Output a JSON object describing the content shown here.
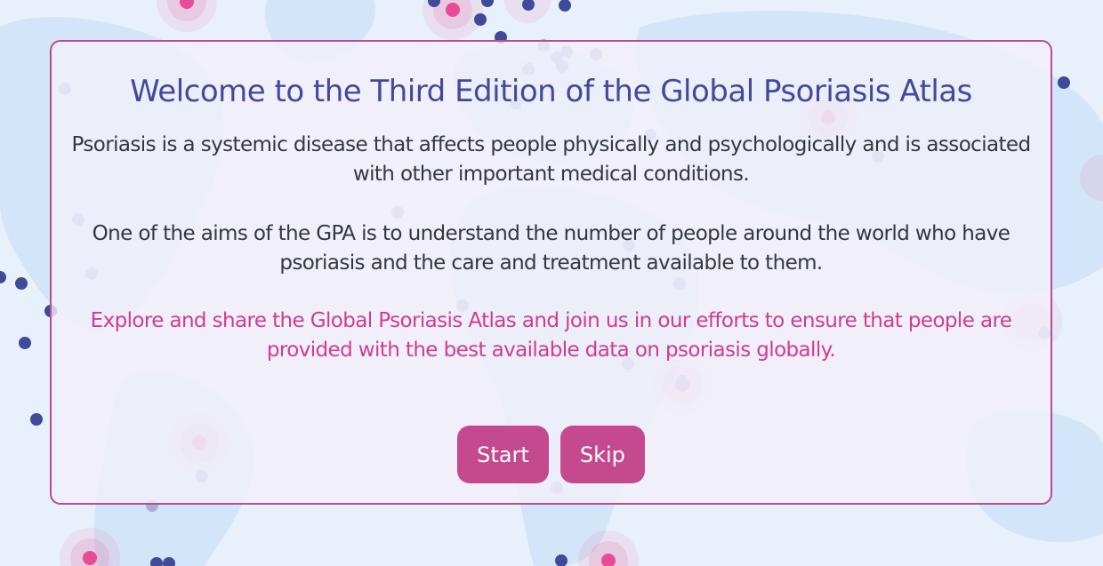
{
  "colors": {
    "background": "#e8f1fb",
    "land": "#d3e5f8",
    "title": "#414a9b",
    "body_text": "#333740",
    "highlight_text": "#d03c8f",
    "button": "#c4498e",
    "border": "#b84d8f",
    "dot_navy": "#3f4a99",
    "dot_pink": "#e84c96"
  },
  "modal": {
    "title": "Welcome to the Third Edition of the Global Psoriasis Atlas",
    "paragraph1": "Psoriasis is a systemic disease that affects people physically and psychologically and is associated with other important medical conditions.",
    "paragraph2": "One of the aims of the GPA is to understand the number of people around the world who have psoriasis and the care and treatment available to them.",
    "paragraph3": "Explore and share the Global Psoriasis Atlas and join us in our efforts to ensure that people are provided with the best available data on psoriasis globally.",
    "start_label": "Start",
    "skip_label": "Skip"
  }
}
